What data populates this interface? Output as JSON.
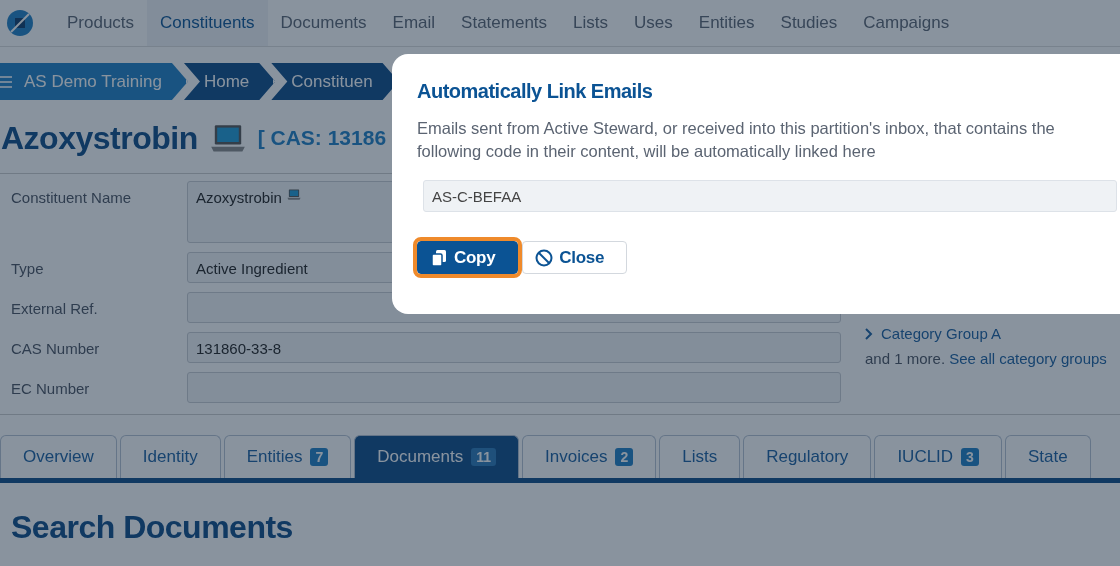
{
  "nav": {
    "items": [
      {
        "label": "Products",
        "selected": false
      },
      {
        "label": "Constituents",
        "selected": true
      },
      {
        "label": "Documents",
        "selected": false
      },
      {
        "label": "Email",
        "selected": false
      },
      {
        "label": "Statements",
        "selected": false
      },
      {
        "label": "Lists",
        "selected": false
      },
      {
        "label": "Uses",
        "selected": false
      },
      {
        "label": "Entities",
        "selected": false
      },
      {
        "label": "Studies",
        "selected": false
      },
      {
        "label": "Campaigns",
        "selected": false
      }
    ]
  },
  "breadcrumb": [
    {
      "label": "AS Demo Training",
      "kind": "root"
    },
    {
      "label": "Home",
      "kind": "crumb"
    },
    {
      "label": "Constituen",
      "kind": "crumb"
    }
  ],
  "header": {
    "title": "Azoxystrobin",
    "cas": "[ CAS: 13186"
  },
  "form": {
    "fields": [
      {
        "label": "Constituent Name",
        "value": "Azoxystrobin",
        "kind": "name"
      },
      {
        "label": "Type",
        "value": "Active Ingredient",
        "kind": "text"
      },
      {
        "label": "External Ref.",
        "kind": "text"
      },
      {
        "label": "CAS Number",
        "value": "131860-33-8",
        "kind": "text"
      },
      {
        "label": "EC Number",
        "kind": "text"
      }
    ]
  },
  "category_groups": {
    "items": [
      {
        "label": "Category Group A"
      }
    ],
    "more": "and 1 more.",
    "link": "See all category groups"
  },
  "tabs": [
    {
      "label": "Overview",
      "selected": false
    },
    {
      "label": "Identity",
      "selected": false
    },
    {
      "label": "Entities",
      "badge": "7",
      "selected": false
    },
    {
      "label": "Documents",
      "badge": "11",
      "selected": true
    },
    {
      "label": "Invoices",
      "badge": "2",
      "selected": false
    },
    {
      "label": "Lists",
      "selected": false
    },
    {
      "label": "Regulatory",
      "selected": false
    },
    {
      "label": "IUCLID",
      "badge": "3",
      "selected": false
    },
    {
      "label": "State",
      "selected": false
    }
  ],
  "section_title": "Search Documents",
  "dialog": {
    "title": "Automatically Link Emails",
    "message": "Emails sent from Active Steward, or received into this partition's inbox, that contains the following code in their content, will be automatically linked here",
    "code": "AS-C-BEFAA",
    "buttons": [
      {
        "label": "Copy",
        "kind": "primary",
        "focused": true
      },
      {
        "label": "Close",
        "kind": "secondary",
        "focused": false
      }
    ]
  }
}
